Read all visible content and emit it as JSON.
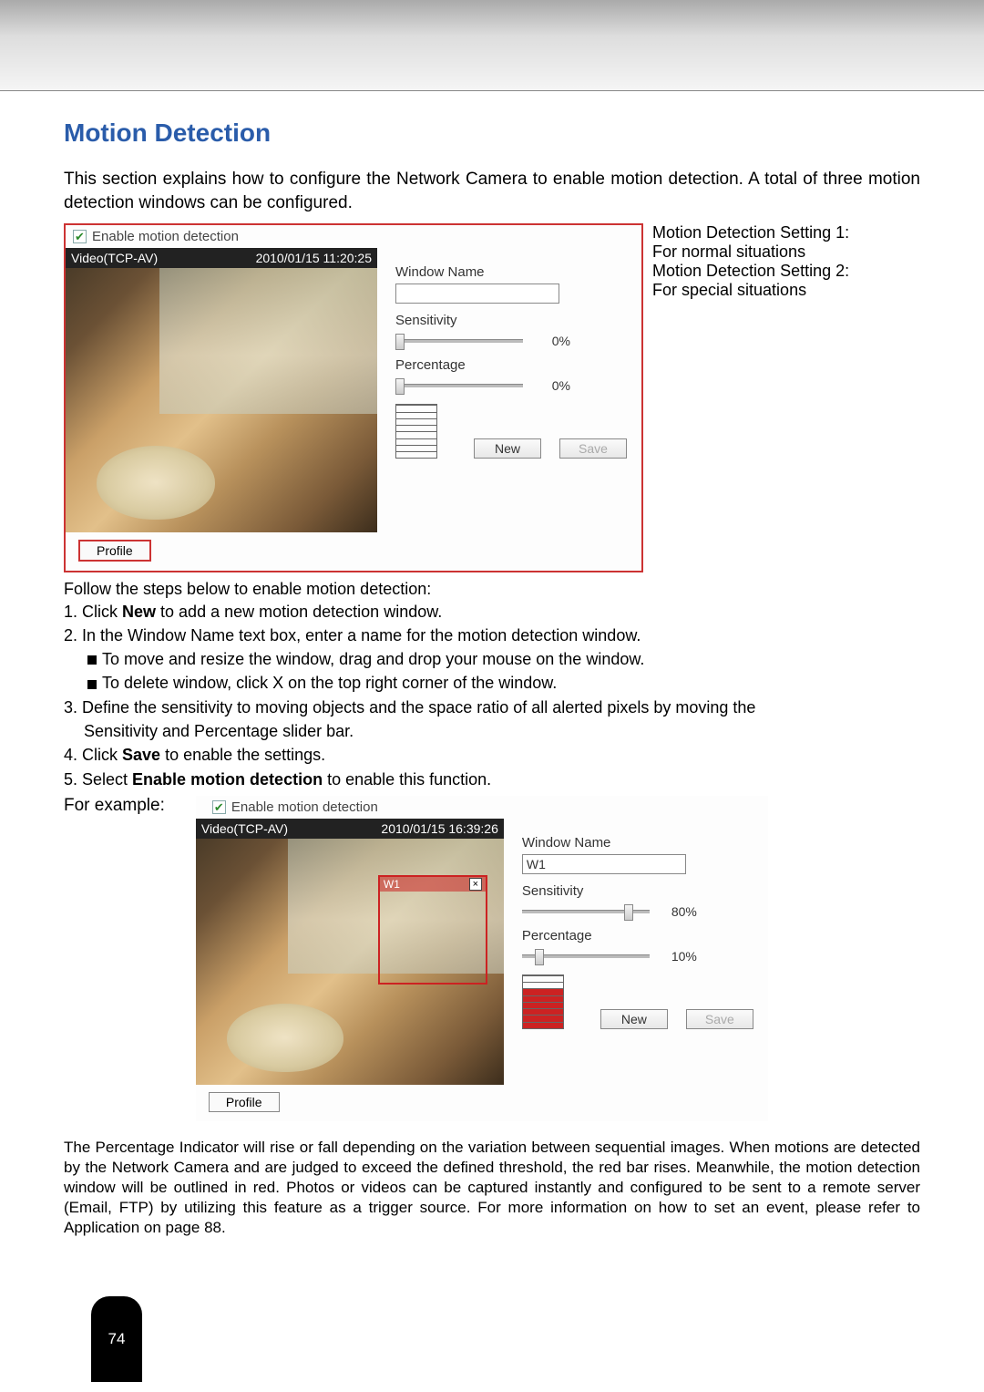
{
  "page": {
    "title": "Motion Detection",
    "intro": "This section explains how to configure the Network Camera to enable motion detection. A total of three motion detection windows can be configured.",
    "page_number": "74"
  },
  "ui1": {
    "enable_label": "Enable motion detection",
    "video_source": "Video(TCP-AV)",
    "timestamp": "2010/01/15 11:20:25",
    "window_name_label": "Window Name",
    "window_name_value": "",
    "sensitivity_label": "Sensitivity",
    "sensitivity_pct": "0%",
    "percentage_label": "Percentage",
    "percentage_pct": "0%",
    "new_btn": "New",
    "save_btn": "Save",
    "profile_btn": "Profile"
  },
  "anno": {
    "s1a": "Motion Detection Setting 1:",
    "s1b": "For normal situations",
    "s2a": "Motion Detection Setting 2:",
    "s2b": "For special situations"
  },
  "steps": {
    "intro": "Follow the steps below to enable motion detection:",
    "s1a": "1. Click ",
    "s1b": "New",
    "s1c": " to add a new motion detection window.",
    "s2": "2. In the Window Name text box, enter a name for the motion detection window.",
    "s2a": "To move and resize the window, drag and drop your mouse on the window.",
    "s2b": "To delete window, click X on the top right corner of the window.",
    "s3": "3. Define the sensitivity to moving objects and the space ratio of all alerted pixels by moving the",
    "s3b": "Sensitivity and Percentage slider bar.",
    "s4a": "4. Click ",
    "s4b": "Save",
    "s4c": " to enable the settings.",
    "s5a": "5. Select ",
    "s5b": "Enable motion detection",
    "s5c": " to enable this function.",
    "example": "For example:"
  },
  "ui2": {
    "enable_label": "Enable motion detection",
    "video_source": "Video(TCP-AV)",
    "timestamp": "2010/01/15 16:39:26",
    "md_window_name": "W1",
    "md_close": "×",
    "window_name_label": "Window Name",
    "window_name_value": "W1",
    "sensitivity_label": "Sensitivity",
    "sensitivity_pct": "80%",
    "percentage_label": "Percentage",
    "percentage_pct": "10%",
    "new_btn": "New",
    "save_btn": "Save",
    "profile_btn": "Profile"
  },
  "footer": {
    "para": "The Percentage Indicator will rise or fall depending on the variation between sequential images. When motions are detected by the Network Camera and are judged to exceed the defined threshold, the red bar rises. Meanwhile, the motion detection window will be outlined in red. Photos or videos can be captured instantly and configured to be sent to a remote server (Email, FTP) by utilizing this feature as a trigger source. For more information on how to set an event, please refer to Application on page 88."
  }
}
